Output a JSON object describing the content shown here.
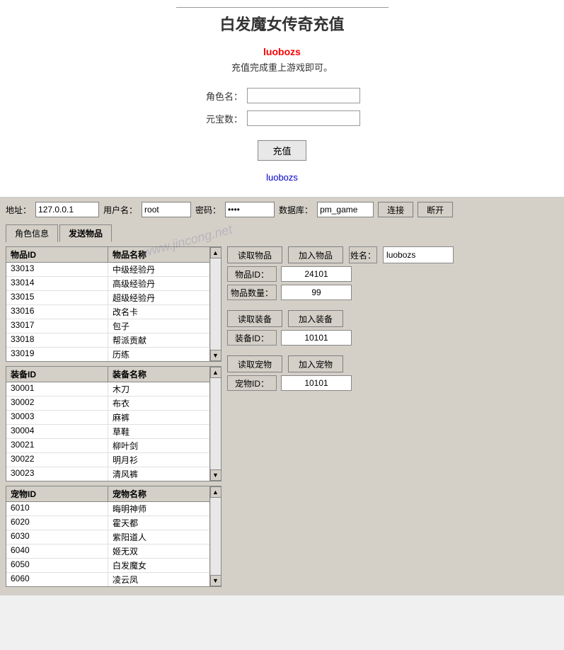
{
  "top": {
    "title": "白发魔女传奇充值",
    "username": "luobozs",
    "subtitle": "充值完成重上游戏即可。",
    "form": {
      "char_label": "角色名：",
      "yuan_label": "元宝数：",
      "char_placeholder": "",
      "yuan_placeholder": "",
      "charge_btn": "充值"
    },
    "bottom_link": "luobozs"
  },
  "toolbar": {
    "addr_label": "地址：",
    "addr_value": "127.0.0.1",
    "user_label": "用户名：",
    "user_value": "root",
    "pwd_label": "密码：",
    "pwd_value": "root",
    "db_label": "数据库：",
    "db_value": "pm_game",
    "connect_btn": "连接",
    "disconnect_btn": "断开"
  },
  "tabs": {
    "items": [
      {
        "label": "角色信息"
      },
      {
        "label": "发送物品"
      }
    ],
    "active": 1
  },
  "items_table": {
    "headers": [
      "物品ID",
      "物品名称"
    ],
    "rows": [
      [
        "33013",
        "中级经验丹"
      ],
      [
        "33014",
        "高级经验丹"
      ],
      [
        "33015",
        "超级经验丹"
      ],
      [
        "33016",
        "改名卡"
      ],
      [
        "33017",
        "包子"
      ],
      [
        "33018",
        "帮派贡献"
      ],
      [
        "33019",
        "历练"
      ]
    ]
  },
  "equip_table": {
    "headers": [
      "装备ID",
      "装备名称"
    ],
    "rows": [
      [
        "30001",
        "木刀"
      ],
      [
        "30002",
        "布衣"
      ],
      [
        "30003",
        "麻裤"
      ],
      [
        "30004",
        "草鞋"
      ],
      [
        "30021",
        "柳叶剑"
      ],
      [
        "30022",
        "明月衫"
      ],
      [
        "30023",
        "清风裤"
      ]
    ]
  },
  "pet_table": {
    "headers": [
      "宠物ID",
      "宠物名称"
    ],
    "rows": [
      [
        "6010",
        "晦明神师"
      ],
      [
        "6020",
        "霍天都"
      ],
      [
        "6030",
        "紫阳道人"
      ],
      [
        "6040",
        "姬无双"
      ],
      [
        "6050",
        "白发魔女"
      ],
      [
        "6060",
        "凌云凤"
      ]
    ]
  },
  "right_panel": {
    "read_item_btn": "读取物品",
    "add_item_btn": "加入物品",
    "name_label": "姓名：",
    "name_value": "luobozs",
    "item_id_label": "物品ID：",
    "item_id_value": "24101",
    "item_qty_label": "物品数量：",
    "item_qty_value": "99",
    "read_equip_btn": "读取装备",
    "add_equip_btn": "加入装备",
    "equip_id_label": "装备ID：",
    "equip_id_value": "10101",
    "read_pet_btn": "读取宠物",
    "add_pet_btn": "加入宠物",
    "pet_id_label": "宠物ID：",
    "pet_id_value": "10101"
  },
  "watermark": "www.jincong.net"
}
